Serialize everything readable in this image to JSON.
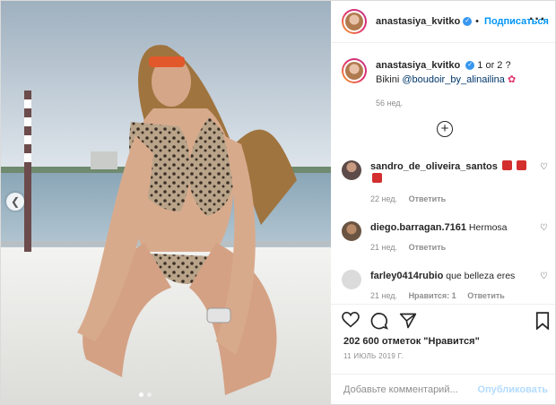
{
  "colors": {
    "accent": "#0095f6",
    "text": "#262626",
    "muted": "#8e8e8e",
    "border": "#dbdbdb"
  },
  "header": {
    "username": "anastasiya_kvitko",
    "follow_label": "Подписаться",
    "more_icon": "more-horizontal-icon"
  },
  "caption": {
    "username": "anastasiya_kvitko",
    "text": "1 or 2 ?",
    "line2_prefix": "Bikini",
    "mention": "@boudoir_by_alinailina",
    "emoji": "flower-emoji",
    "time": "56 нед."
  },
  "load_more_icon": "plus-circle-icon",
  "comments": [
    {
      "username": "sandro_de_oliveira_santos",
      "text": "",
      "time": "22 нед.",
      "reply": "Ответить",
      "likes": ""
    },
    {
      "username": "diego.barragan.7161",
      "text": "Hermosa",
      "time": "21 нед.",
      "reply": "Ответить",
      "likes": ""
    },
    {
      "username": "farley0414rubio",
      "text": "que belleza eres",
      "time": "21 нед.",
      "likes": "Нравится: 1",
      "reply": "Ответить"
    }
  ],
  "likes_text": "202 600 отметок \"Нравится\"",
  "date_text": "11 ИЮЛЬ 2019 Г.",
  "add_comment": {
    "placeholder": "Добавьте комментарий...",
    "publish_label": "Опубликовать"
  }
}
